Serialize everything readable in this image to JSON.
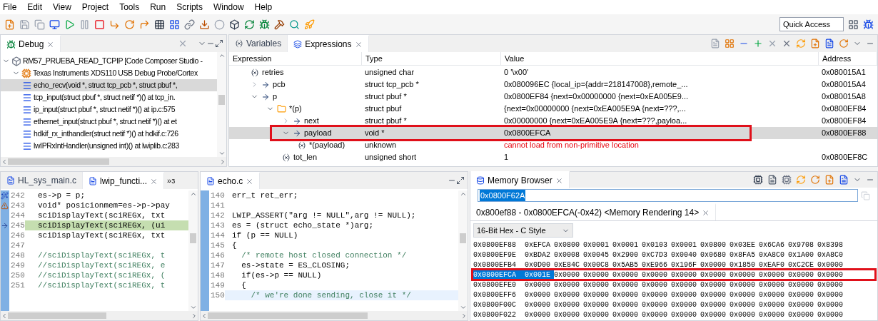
{
  "menu": [
    "File",
    "Edit",
    "View",
    "Project",
    "Tools",
    "Run",
    "Scripts",
    "Window",
    "Help"
  ],
  "quick_access": {
    "placeholder": "Quick Access"
  },
  "debug": {
    "tab": {
      "label": "Debug",
      "selected": true
    },
    "tree": [
      {
        "label": "RM57_PRUEBA_READ_TCPIP [Code Composer Studio -",
        "kind": "session",
        "expanded": true,
        "selected": false,
        "children": [
          {
            "label": "Texas Instruments XDS110 USB Debug Probe/Cortex",
            "kind": "probe",
            "expanded": true,
            "selected": false,
            "children": [
              {
                "label": "echo_recv(void *, struct tcp_pcb *, struct pbuf *,",
                "kind": "frame",
                "selected": true
              },
              {
                "label": "tcp_input(struct pbuf *, struct netif *)() at tcp_in.",
                "kind": "frame",
                "selected": false
              },
              {
                "label": "ip_input(struct pbuf *, struct netif *)() at ip.c:575",
                "kind": "frame",
                "selected": false
              },
              {
                "label": "ethernet_input(struct pbuf *, struct netif *)() at et",
                "kind": "frame",
                "selected": false
              },
              {
                "label": "hdkif_rx_inthandler(struct netif *)() at hdkif.c:726",
                "kind": "frame",
                "selected": false
              },
              {
                "label": "lwIPRxIntHandler(unsigned int)() at lwiplib.c:283",
                "kind": "frame",
                "selected": false
              }
            ]
          }
        ]
      }
    ]
  },
  "expressions": {
    "tabs": [
      {
        "label": "Variables",
        "selected": false
      },
      {
        "label": "Expressions",
        "selected": true
      }
    ],
    "columns": [
      "Expression",
      "Type",
      "Value",
      "Address"
    ],
    "rows": [
      {
        "name": "retries",
        "kind": "variable",
        "type": "unsigned char",
        "value": "0 '\\x00'",
        "address": "0x080015A1",
        "selected": false,
        "annotated": false
      },
      {
        "name": "pcb",
        "kind": "pointer",
        "expanded": false,
        "type": "struct tcp_pcb *",
        "value": "0x080096EC {local_ip={addr=218147008},remote_...",
        "address": "0x080015A4",
        "selected": false,
        "annotated": false
      },
      {
        "name": "p",
        "kind": "pointer",
        "expanded": true,
        "type": "struct pbuf *",
        "value": "0x0800EF84 {next=0x00000000 {next=0xEA005E9...",
        "address": "0x080015A8",
        "selected": false,
        "annotated": false,
        "children": [
          {
            "name": "*(p)",
            "kind": "struct",
            "expanded": true,
            "type": "struct pbuf",
            "value": "{next=0x00000000 {next=0xEA005E9A {next=???,...",
            "address": "0x0800EF84",
            "selected": false,
            "annotated": false,
            "children": [
              {
                "name": "next",
                "kind": "pointer",
                "expanded": false,
                "type": "struct pbuf *",
                "value": "0x00000000 {next=0xEA005E9A {next=???,payloa...",
                "address": "0x0800EF84",
                "selected": false,
                "annotated": false
              },
              {
                "name": "payload",
                "kind": "pointer",
                "expanded": true,
                "type": "void *",
                "value": "0x0800EFCA",
                "address": "0x0800EF88",
                "selected": true,
                "annotated": true,
                "children": [
                  {
                    "name": "*(payload)",
                    "kind": "variable",
                    "type": "unknown",
                    "value": "cannot load from non-primitive location",
                    "error": true,
                    "selected": false,
                    "annotated": false
                  }
                ]
              },
              {
                "name": "tot_len",
                "kind": "variable",
                "type": "unsigned short",
                "value": "1",
                "address": "0x0800EF8C",
                "selected": false,
                "annotated": false
              }
            ]
          }
        ]
      }
    ]
  },
  "editor_left": {
    "tabs": [
      {
        "label": "HL_sys_main.c",
        "selected": false
      },
      {
        "label": "lwip_functi...",
        "selected": true
      }
    ],
    "overflow": {
      "glyph": "»",
      "count": "3"
    },
    "lines": [
      {
        "number": "242",
        "text": "es->p = p;",
        "kind": "code",
        "marker": {
          "kind": "debug"
        },
        "current": false
      },
      {
        "number": "243",
        "text": "void* posicionmem=es->p->pay",
        "kind": "code",
        "marker": {
          "kind": "warning"
        },
        "current": false
      },
      {
        "number": "244",
        "text": "sciDisplayText(sciREGx, txt",
        "kind": "code",
        "current": false
      },
      {
        "number": "245",
        "text": "sciDisplayText(sciREGx, (ui",
        "kind": "code",
        "marker": {
          "kind": "pointer"
        },
        "current": true
      },
      {
        "number": "246",
        "text": "sciDisplayText(sciREGx, txt",
        "kind": "code",
        "current": false
      },
      {
        "number": "247",
        "kind": "blank",
        "current": false
      },
      {
        "number": "248",
        "text": "//sciDisplayText(sciREGx, t",
        "kind": "comment",
        "current": false
      },
      {
        "number": "249",
        "text": "//sciDisplayText(sciREGx, e",
        "kind": "comment",
        "current": false
      },
      {
        "number": "250",
        "text": "//sciDisplayText(sciREGx, (",
        "kind": "comment",
        "current": false
      },
      {
        "number": "251",
        "text": "//sciDisplayText(sciREGx, t",
        "kind": "comment",
        "current": false
      }
    ]
  },
  "editor_echo": {
    "tab": {
      "label": "echo.c",
      "selected": true
    },
    "lines": [
      {
        "number": "140",
        "text": "err_t ret_err;",
        "kind": "code",
        "current": false
      },
      {
        "number": "141",
        "kind": "blank",
        "current": false
      },
      {
        "number": "142",
        "text": "LWIP_ASSERT(\"arg != NULL\",arg != NULL);",
        "kind": "code",
        "current": false
      },
      {
        "number": "143",
        "text": "es = (struct echo_state *)arg;",
        "kind": "code",
        "current": false
      },
      {
        "number": "144",
        "text": "if (p == NULL)",
        "kind": "code",
        "current": false
      },
      {
        "number": "145",
        "text": "{",
        "kind": "code",
        "current": false
      },
      {
        "number": "146",
        "text": "  /* remote host closed connection */",
        "kind": "comment",
        "current": false
      },
      {
        "number": "147",
        "text": "  es->state = ES_CLOSING;",
        "kind": "code",
        "current": false
      },
      {
        "number": "148",
        "text": "  if(es->p == NULL)",
        "kind": "code",
        "current": false
      },
      {
        "number": "149",
        "text": "  {",
        "kind": "code",
        "current": false
      },
      {
        "number": "150",
        "text": "    /* we're done sending, close it */",
        "kind": "comment",
        "current": true
      }
    ]
  },
  "memory": {
    "tab": {
      "label": "Memory Browser",
      "selected": true
    },
    "address_field": {
      "value": "0x0800F62A"
    },
    "rendering_tab": {
      "label": "0x800ef88 - 0x0800EFCA(-0x42) <Memory Rendering 14>",
      "selected": true
    },
    "format": {
      "value": "16-Bit Hex - C Style"
    },
    "rows": [
      {
        "address": "0x0800EF88",
        "values": [
          "0xEFCA",
          "0x0800",
          "0x0001",
          "0x0001",
          "0x0103",
          "0x0001",
          "0x0800",
          "0x03EE",
          "0x6CA6",
          "0x9708",
          "0x8398"
        ],
        "selected": false,
        "annotated": false
      },
      {
        "address": "0x0800EF9E",
        "values": [
          "0xBDA2",
          "0x0008",
          "0x0045",
          "0x2900",
          "0xC7D3",
          "0x0040",
          "0x0680",
          "0x8FA5",
          "0xA8C0",
          "0x1A00",
          "0xA8C0"
        ],
        "selected": false,
        "annotated": false
      },
      {
        "address": "0x0800EFB4",
        "values": [
          "0x0D00",
          "0xE84C",
          "0x00C8",
          "0x5AB5",
          "0xE966",
          "0x196F",
          "0x0000",
          "0x1850",
          "0xEAF0",
          "0xC2CE",
          "0x0000"
        ],
        "selected": false,
        "annotated": false
      },
      {
        "address": "0x0800EFCA",
        "values": [
          "0x001E",
          "0x0000",
          "0x0000",
          "0x0000",
          "0x0000",
          "0x0000",
          "0x0000",
          "0x0000",
          "0x0000",
          "0x0000",
          "0x0000"
        ],
        "selected": true,
        "annotated": true
      },
      {
        "address": "0x0800EFE0",
        "values": [
          "0x0000",
          "0x0000",
          "0x0000",
          "0x0000",
          "0x0000",
          "0x0000",
          "0x0000",
          "0x0000",
          "0x0000",
          "0x0000",
          "0x0000"
        ],
        "selected": false,
        "annotated": false
      },
      {
        "address": "0x0800EFF6",
        "values": [
          "0x0000",
          "0x0000",
          "0x0000",
          "0x0000",
          "0x0000",
          "0x0000",
          "0x0000",
          "0x0000",
          "0x0000",
          "0x0000",
          "0x0000"
        ],
        "selected": false,
        "annotated": false
      },
      {
        "address": "0x0800F00C",
        "values": [
          "0x0000",
          "0x0000",
          "0x0000",
          "0x0000",
          "0x0000",
          "0x0000",
          "0x0000",
          "0x0000",
          "0x0000",
          "0x0000",
          "0x0000"
        ],
        "selected": false,
        "annotated": false
      },
      {
        "address": "0x0800F022",
        "values": [
          "0x0000",
          "0x0000",
          "0x0000",
          "0x0000",
          "0x0000",
          "0x0000",
          "0x0000",
          "0x0000",
          "0x0000",
          "0x0000",
          "0x0000"
        ],
        "selected": false,
        "annotated": false
      }
    ]
  }
}
